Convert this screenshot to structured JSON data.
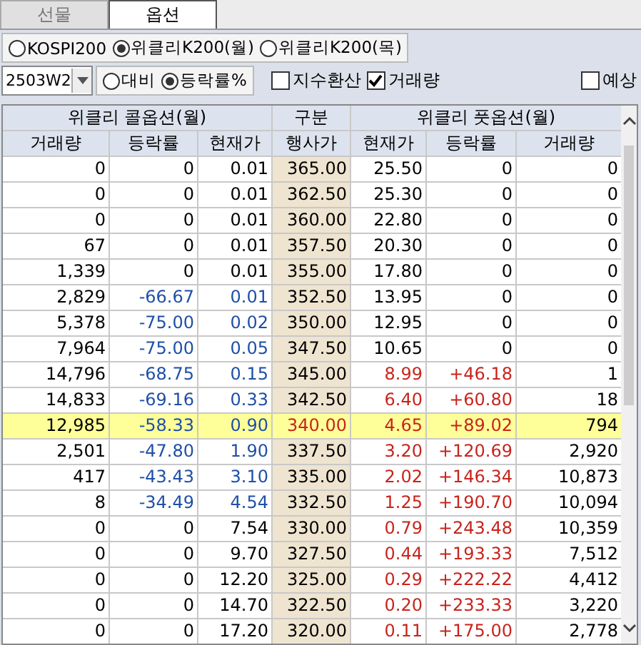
{
  "tabs": [
    {
      "label": "선물",
      "selected": false
    },
    {
      "label": "옵션",
      "selected": true
    }
  ],
  "markets": [
    {
      "label": "KOSPI200",
      "selected": false
    },
    {
      "label": "위클리K200(월)",
      "selected": true
    },
    {
      "label": "위클리K200(목)",
      "selected": false
    }
  ],
  "expiry": {
    "value": "2503W2"
  },
  "modes": [
    {
      "label": "대비",
      "selected": false
    },
    {
      "label": "등락률%",
      "selected": true
    }
  ],
  "options": [
    {
      "label": "지수환산",
      "checked": false
    },
    {
      "label": "거래량",
      "checked": true
    }
  ],
  "forecast": {
    "label": "예상",
    "checked": false
  },
  "table": {
    "groups": [
      "위클리 콜옵션(월)",
      "구분",
      "위클리 풋옵션(월)"
    ],
    "columns": [
      "거래량",
      "등락률",
      "현재가",
      "행사가",
      "현재가",
      "등락률",
      "거래량"
    ],
    "rows": [
      {
        "cells": [
          "0",
          "0",
          "0.01",
          "365.00",
          "25.50",
          "0",
          "0"
        ],
        "call_down": false,
        "put_up": false,
        "selected": false
      },
      {
        "cells": [
          "0",
          "0",
          "0.01",
          "362.50",
          "25.30",
          "0",
          "0"
        ],
        "call_down": false,
        "put_up": false,
        "selected": false
      },
      {
        "cells": [
          "0",
          "0",
          "0.01",
          "360.00",
          "22.80",
          "0",
          "0"
        ],
        "call_down": false,
        "put_up": false,
        "selected": false
      },
      {
        "cells": [
          "67",
          "0",
          "0.01",
          "357.50",
          "20.30",
          "0",
          "0"
        ],
        "call_down": false,
        "put_up": false,
        "selected": false
      },
      {
        "cells": [
          "1,339",
          "0",
          "0.01",
          "355.00",
          "17.80",
          "0",
          "0"
        ],
        "call_down": false,
        "put_up": false,
        "selected": false
      },
      {
        "cells": [
          "2,829",
          "-66.67",
          "0.01",
          "352.50",
          "13.95",
          "0",
          "0"
        ],
        "call_down": true,
        "put_up": false,
        "selected": false
      },
      {
        "cells": [
          "5,378",
          "-75.00",
          "0.02",
          "350.00",
          "12.95",
          "0",
          "0"
        ],
        "call_down": true,
        "put_up": false,
        "selected": false
      },
      {
        "cells": [
          "7,964",
          "-75.00",
          "0.05",
          "347.50",
          "10.65",
          "0",
          "0"
        ],
        "call_down": true,
        "put_up": false,
        "selected": false
      },
      {
        "cells": [
          "14,796",
          "-68.75",
          "0.15",
          "345.00",
          "8.99",
          "+46.18",
          "1"
        ],
        "call_down": true,
        "put_up": true,
        "selected": false
      },
      {
        "cells": [
          "14,833",
          "-69.16",
          "0.33",
          "342.50",
          "6.40",
          "+60.80",
          "18"
        ],
        "call_down": true,
        "put_up": true,
        "selected": false
      },
      {
        "cells": [
          "12,985",
          "-58.33",
          "0.90",
          "340.00",
          "4.65",
          "+89.02",
          "794"
        ],
        "call_down": true,
        "put_up": true,
        "selected": true
      },
      {
        "cells": [
          "2,501",
          "-47.80",
          "1.90",
          "337.50",
          "3.20",
          "+120.69",
          "2,920"
        ],
        "call_down": true,
        "put_up": true,
        "selected": false
      },
      {
        "cells": [
          "417",
          "-43.43",
          "3.10",
          "335.00",
          "2.02",
          "+146.34",
          "10,873"
        ],
        "call_down": true,
        "put_up": true,
        "selected": false
      },
      {
        "cells": [
          "8",
          "-34.49",
          "4.54",
          "332.50",
          "1.25",
          "+190.70",
          "10,094"
        ],
        "call_down": true,
        "put_up": true,
        "selected": false
      },
      {
        "cells": [
          "0",
          "0",
          "7.54",
          "330.00",
          "0.79",
          "+243.48",
          "10,359"
        ],
        "call_down": false,
        "put_up": true,
        "selected": false
      },
      {
        "cells": [
          "0",
          "0",
          "9.70",
          "327.50",
          "0.44",
          "+193.33",
          "7,512"
        ],
        "call_down": false,
        "put_up": true,
        "selected": false
      },
      {
        "cells": [
          "0",
          "0",
          "12.20",
          "325.00",
          "0.29",
          "+222.22",
          "4,412"
        ],
        "call_down": false,
        "put_up": true,
        "selected": false
      },
      {
        "cells": [
          "0",
          "0",
          "14.70",
          "322.50",
          "0.20",
          "+233.33",
          "3,220"
        ],
        "call_down": false,
        "put_up": true,
        "selected": false
      },
      {
        "cells": [
          "0",
          "0",
          "17.20",
          "320.00",
          "0.11",
          "+175.00",
          "2,778"
        ],
        "call_down": false,
        "put_up": true,
        "selected": false
      }
    ]
  }
}
